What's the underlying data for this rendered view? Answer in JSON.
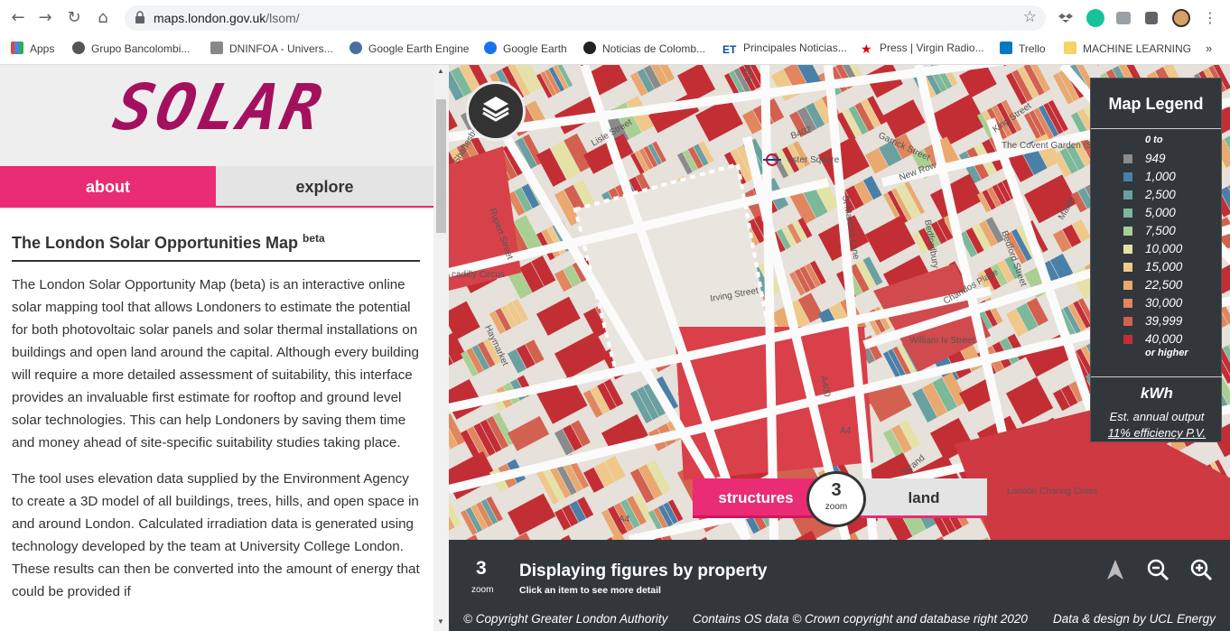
{
  "browser": {
    "url_host": "maps.london.gov.uk",
    "url_path": "/lsom/",
    "bookmarks": [
      "Apps",
      "Grupo Bancolombi...",
      "DNINFOA - Univers...",
      "Google Earth Engine",
      "Google Earth",
      "Noticias de Colomb...",
      "Principales Noticias...",
      "Press | Virgin Radio...",
      "Trello",
      "MACHINE LEARNING",
      "»"
    ]
  },
  "sidebar": {
    "logo": "SOLAR",
    "tabs": [
      "about",
      "explore"
    ],
    "heading": "The London Solar Opportunities Map",
    "heading_sup": "beta",
    "para1": "The London Solar Opportunity Map (beta) is an interactive online solar mapping tool that allows Londoners to estimate the potential for both photovoltaic solar panels and solar thermal installations on buildings and open land around the capital. Although every building will require a more detailed assessment of suitability, this interface provides an invaluable first estimate for rooftop and ground level solar technologies. This can help Londoners by saving them time and money ahead of site-specific suitability studies taking place.",
    "para2": "The tool uses elevation data supplied by the Environment Agency to create a 3D model of all buildings, trees, hills, and open space in and around London. Calculated irradiation data is generated using technology developed by the team at University College London. These results can then be converted into the amount of energy that could be provided if"
  },
  "map": {
    "street_labels": [
      "A400",
      "B402",
      "Garrick Street",
      "King Street",
      "Lisle Street",
      "Shaftesbury",
      "Rupert Street",
      "New Row",
      "St Martin's Lane",
      "Bedfordbury",
      "Bedford Street",
      "Chandos Place",
      "Irving Street",
      "William Iv Street",
      "Haymarket",
      "A400",
      "A4",
      "Strand",
      "A4",
      "cadilly Circus",
      "The Covent Garden (Site O",
      "ester Square",
      "London Charing Cross",
      "Maide"
    ],
    "legend": {
      "title": "Map Legend",
      "top_label": "0 to",
      "items": [
        {
          "label": "949",
          "color": "#8b8b8b"
        },
        {
          "label": "1,000",
          "color": "#4a7fa8"
        },
        {
          "label": "2,500",
          "color": "#6aa0a0"
        },
        {
          "label": "5,000",
          "color": "#7cb89a"
        },
        {
          "label": "7,500",
          "color": "#a9cf93"
        },
        {
          "label": "10,000",
          "color": "#e4e2a6"
        },
        {
          "label": "15,000",
          "color": "#efc88a"
        },
        {
          "label": "22,500",
          "color": "#eaa96e"
        },
        {
          "label": "30,000",
          "color": "#e1865e"
        },
        {
          "label": "39,999",
          "color": "#d3614f"
        },
        {
          "label": "40,000",
          "color": "#c32e35"
        }
      ],
      "bottom_label": "or higher",
      "unit": "kWh",
      "footer1": "Est. annual output",
      "footer2": "11% efficiency P.V."
    },
    "modes": {
      "structures": "structures",
      "land": "land"
    },
    "zoom": {
      "value": "3",
      "label": "zoom"
    }
  },
  "bottom_bar": {
    "zoom_value": "3",
    "zoom_label": "zoom",
    "title": "Displaying figures by property",
    "subtitle": "Click an item to see more detail",
    "copyright1": "© Copyright Greater London Authority",
    "copyright2": "Contains OS data © Crown copyright and database right 2020",
    "copyright3": "Data & design by UCL Energy"
  }
}
